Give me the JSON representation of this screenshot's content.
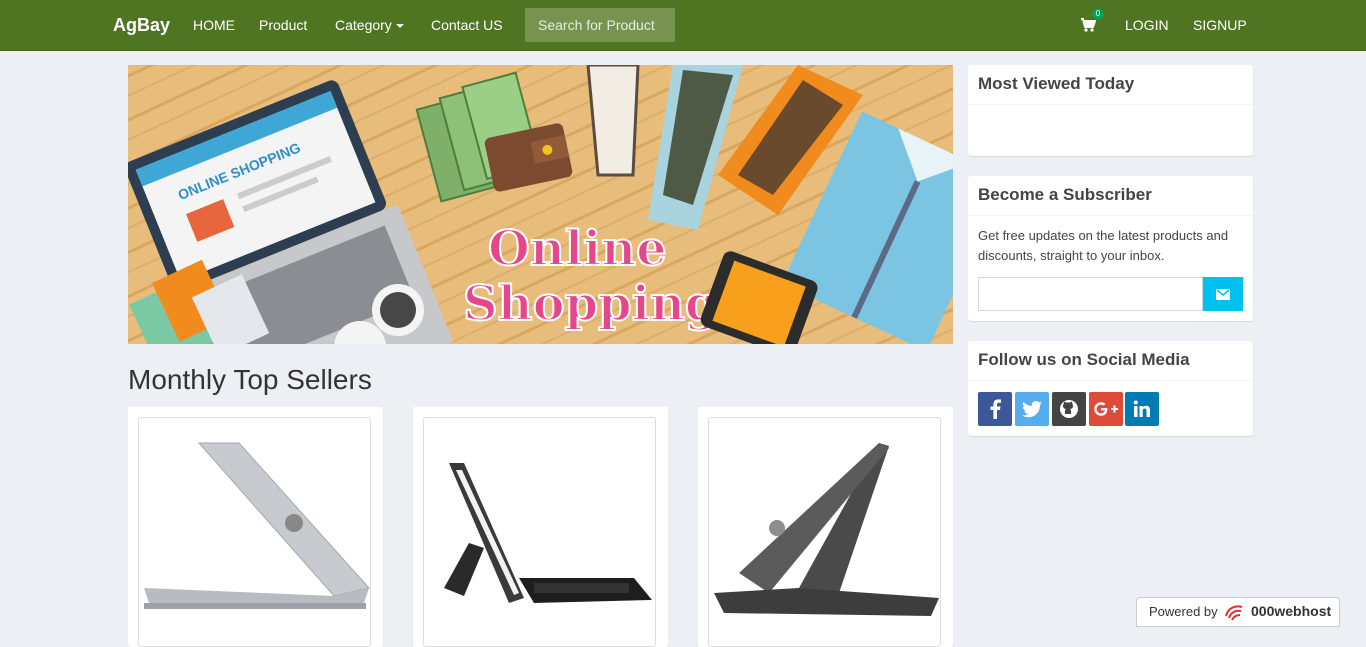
{
  "nav": {
    "brand": "AgBay",
    "links": [
      "HOME",
      "Product",
      "Category",
      "Contact US"
    ],
    "search_placeholder": "Search for Product",
    "cart_count": "0",
    "login": "LOGIN",
    "signup": "SIGNUP"
  },
  "banner": {
    "laptop_screen_text": "ONLINE SHOPPING",
    "headline_line1": "Online",
    "headline_line2": "Shopping"
  },
  "main": {
    "section_title": "Monthly Top Sellers"
  },
  "sidebar": {
    "most_viewed_title": "Most Viewed Today",
    "subscriber_title": "Become a Subscriber",
    "subscriber_text": "Get free updates on the latest products and discounts, straight to your inbox.",
    "social_title": "Follow us on Social Media"
  },
  "footer": {
    "powered_by": "Powered by",
    "host_name": "000webhost"
  },
  "colors": {
    "navbar": "#4f7522",
    "accent_button": "#00c0ef",
    "facebook": "#3b5998",
    "twitter": "#55acee",
    "github": "#444444",
    "google": "#dd4b39",
    "linkedin": "#007bb6"
  }
}
